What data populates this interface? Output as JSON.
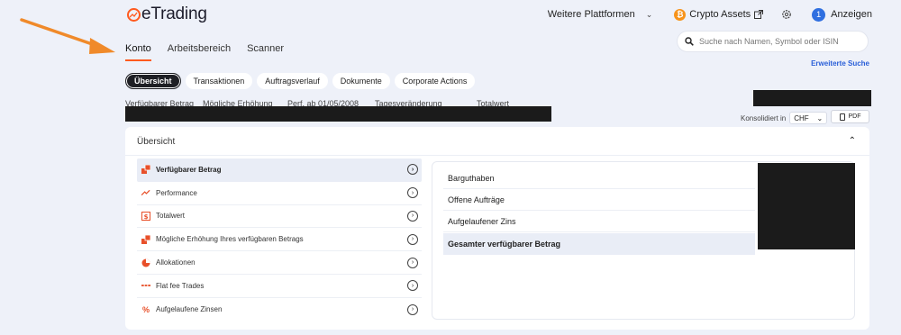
{
  "brand": {
    "logo_text": "eTrading",
    "accent": "#ff5a1f"
  },
  "topbar": {
    "platforms_label": "Weitere Plattformen",
    "crypto_label": "Crypto Assets",
    "notifications_count": "1",
    "notifications_label": "Anzeigen"
  },
  "main_tabs": [
    {
      "label": "Konto",
      "active": true
    },
    {
      "label": "Arbeitsbereich",
      "active": false
    },
    {
      "label": "Scanner",
      "active": false
    }
  ],
  "search": {
    "placeholder": "Suche nach Namen, Symbol oder ISIN",
    "advanced_label": "Erweiterte Suche"
  },
  "sub_tabs": [
    {
      "label": "Übersicht",
      "active": true
    },
    {
      "label": "Transaktionen",
      "active": false
    },
    {
      "label": "Auftragsverlauf",
      "active": false
    },
    {
      "label": "Dokumente",
      "active": false
    },
    {
      "label": "Corporate Actions",
      "active": false
    }
  ],
  "summary_labels": [
    "Verfügbarer Betrag",
    "Mögliche Erhöhung",
    "Perf. ab 01/05/2008",
    "Tagesveränderung",
    "Totalwert"
  ],
  "consolidation": {
    "label": "Konsolidiert in",
    "currency": "CHF",
    "pdf_label": "PDF"
  },
  "panel": {
    "title": "Übersicht",
    "left_items": [
      {
        "label": "Verfügbarer Betrag",
        "icon": "cash-stack-icon",
        "active": true
      },
      {
        "label": "Performance",
        "icon": "trend-up-icon",
        "active": false
      },
      {
        "label": "Totalwert",
        "icon": "dollar-note-icon",
        "active": false
      },
      {
        "label": "Mögliche Erhöhung Ihres verfügbaren Betrags",
        "icon": "cash-stack-icon",
        "active": false
      },
      {
        "label": "Allokationen",
        "icon": "pie-chart-icon",
        "active": false
      },
      {
        "label": "Flat fee Trades",
        "icon": "dots-icon",
        "active": false
      },
      {
        "label": "Aufgelaufene Zinsen",
        "icon": "percent-icon",
        "active": false
      }
    ],
    "right_rows": [
      {
        "label": "Barguthaben"
      },
      {
        "label": "Offene Aufträge"
      },
      {
        "label": "Aufgelaufener Zins"
      },
      {
        "label": "Gesamter verfügbarer Betrag"
      }
    ]
  }
}
